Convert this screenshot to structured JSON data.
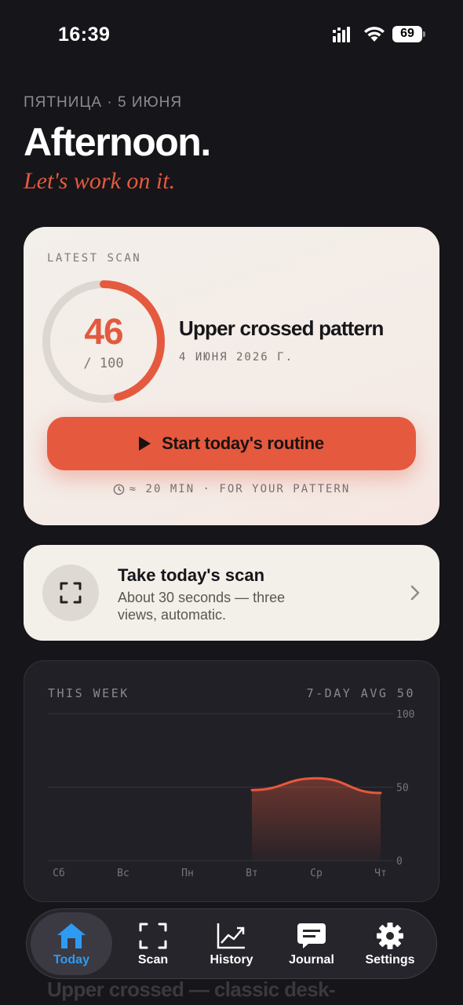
{
  "status": {
    "time": "16:39",
    "battery": "69"
  },
  "header": {
    "date": "ПЯТНИЦА · 5 ИЮНЯ",
    "greeting": "Afternoon.",
    "tagline": "Let's work on it."
  },
  "latest_scan": {
    "label": "LATEST SCAN",
    "score": "46",
    "score_max": "/ 100",
    "score_fraction": 0.46,
    "pattern": "Upper crossed pattern",
    "date": "4 ИЮНЯ 2026 Г.",
    "button_label": "Start today's routine",
    "meta": "≈ 20 MIN · FOR YOUR PATTERN"
  },
  "take_scan": {
    "title": "Take today's scan",
    "description": "About 30 seconds — three views, automatic."
  },
  "week": {
    "label": "THIS WEEK",
    "avg_label": "7-DAY AVG 50"
  },
  "chart_data": {
    "type": "area",
    "categories": [
      "Сб",
      "Вс",
      "Пн",
      "Вт",
      "Ср",
      "Чт"
    ],
    "yticks": [
      "100",
      "50",
      "0"
    ],
    "ylim": [
      0,
      100
    ],
    "values": [
      null,
      null,
      null,
      48,
      56,
      46
    ],
    "grid": true,
    "color": "#e5593e"
  },
  "tabs": [
    {
      "label": "Today",
      "icon": "home-icon",
      "active": true
    },
    {
      "label": "Scan",
      "icon": "scan-frame-icon",
      "active": false
    },
    {
      "label": "History",
      "icon": "chart-line-icon",
      "active": false
    },
    {
      "label": "Journal",
      "icon": "message-icon",
      "active": false
    },
    {
      "label": "Settings",
      "icon": "gear-icon",
      "active": false
    }
  ],
  "peek_text": "Upper crossed — classic desk-",
  "colors": {
    "accent": "#e5593e",
    "active_tab": "#2f9bf0",
    "background": "#161519"
  }
}
